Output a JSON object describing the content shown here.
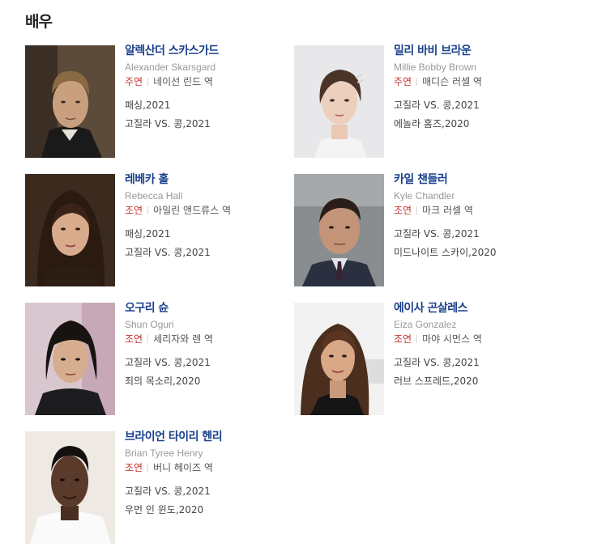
{
  "section": {
    "title": "배우"
  },
  "cast": [
    {
      "name": "알렉산더 스카스가드",
      "name_en": "Alexander Skarsgard",
      "role_type": "주연",
      "role": "네이선 린드 역",
      "works": [
        "패싱,2021",
        "고질라 VS. 콩,2021"
      ]
    },
    {
      "name": "밀리 바비 브라운",
      "name_en": "Millie Bobby Brown",
      "role_type": "주연",
      "role": "매디슨 러셀 역",
      "works": [
        "고질라 VS. 콩,2021",
        "에놀라 홈즈,2020"
      ]
    },
    {
      "name": "레베카 홀",
      "name_en": "Rebecca Hall",
      "role_type": "조연",
      "role": "아일린 앤드류스 역",
      "works": [
        "패싱,2021",
        "고질라 VS. 콩,2021"
      ]
    },
    {
      "name": "카일 챈들러",
      "name_en": "Kyle Chandler",
      "role_type": "조연",
      "role": "마크 러셀 역",
      "works": [
        "고질라 VS. 콩,2021",
        "미드나이트 스카이,2020"
      ]
    },
    {
      "name": "오구리 슌",
      "name_en": "Shun Oguri",
      "role_type": "조연",
      "role": "세리자와 렌 역",
      "works": [
        "고질라 VS. 콩,2021",
        "죄의 목소리,2020"
      ]
    },
    {
      "name": "에이사 곤살레스",
      "name_en": "Eiza Gonzalez",
      "role_type": "조연",
      "role": "마야 시먼스 역",
      "works": [
        "고질라 VS. 콩,2021",
        "러브 스프레드,2020"
      ]
    },
    {
      "name": "브라이언 타이리 헨리",
      "name_en": "Brian Tyree Henry",
      "role_type": "조연",
      "role": "버니 헤이즈 역",
      "works": [
        "고질라 VS. 콩,2021",
        "우먼 인 윈도,2020"
      ]
    }
  ],
  "colors": {
    "name": "#1a3f8c",
    "role_type": "#c4352f",
    "english": "#999999"
  }
}
